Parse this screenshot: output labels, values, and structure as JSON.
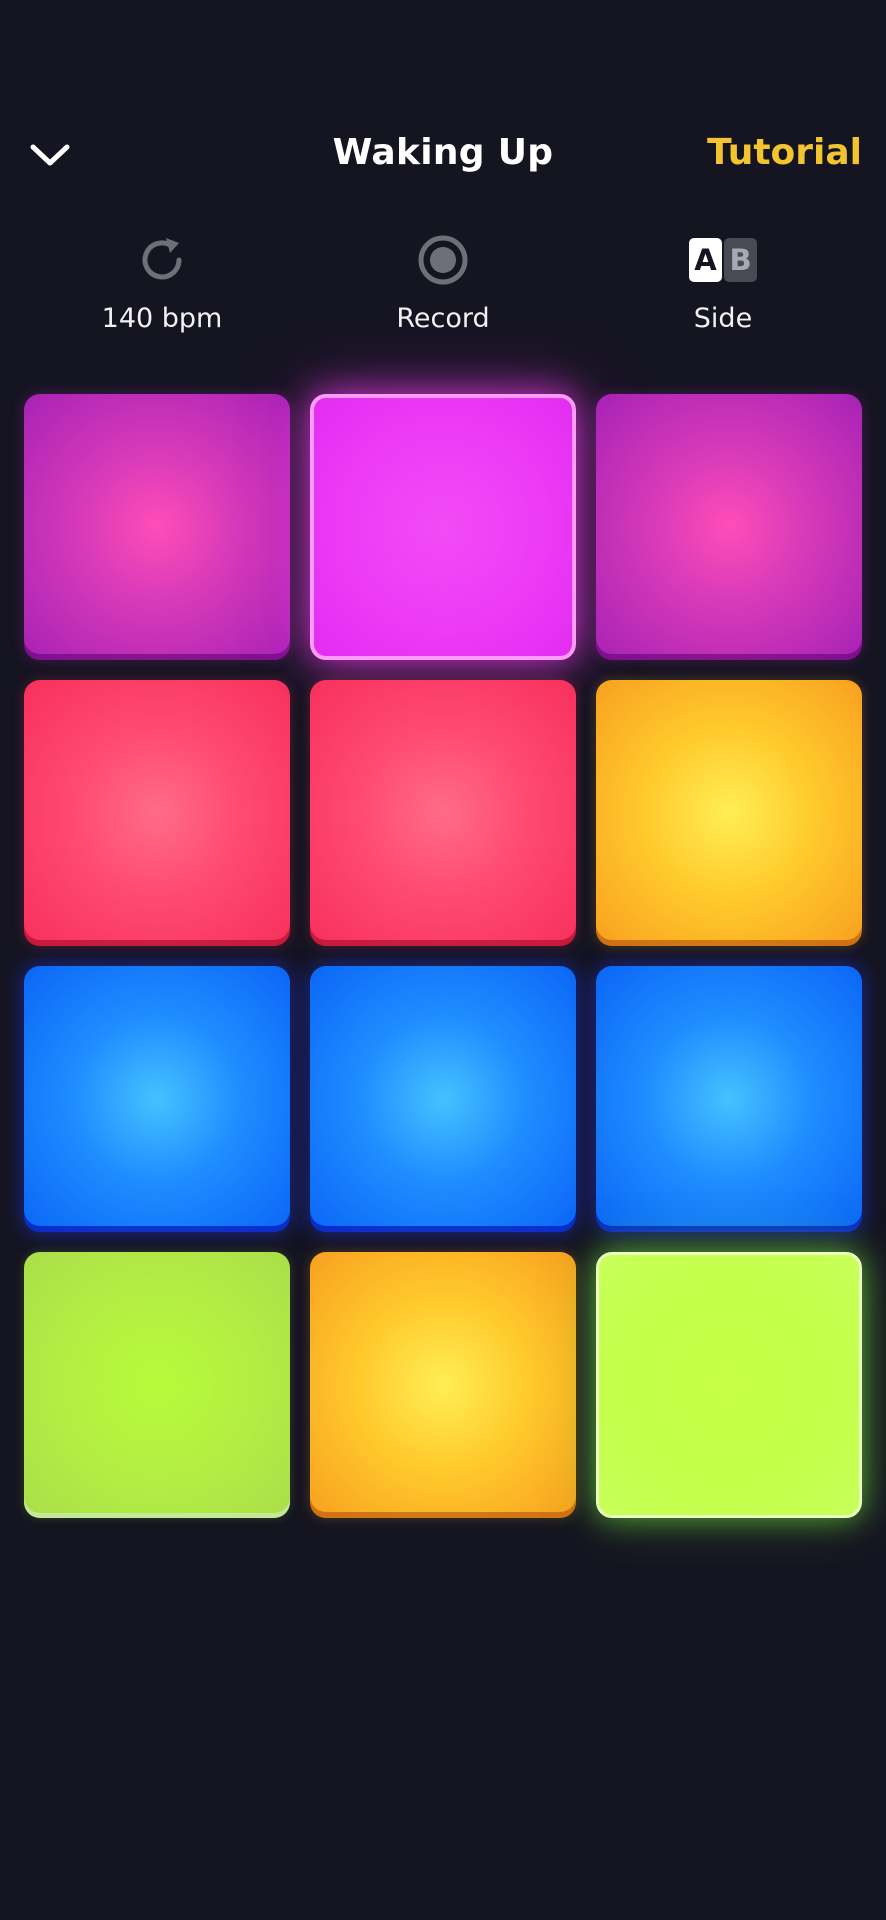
{
  "header": {
    "back_icon": "chevron-down-icon",
    "title": "Waking Up",
    "tutorial_label": "Tutorial",
    "tutorial_color": "#f4c430"
  },
  "controls": {
    "tempo": {
      "icon": "refresh-icon",
      "label": "140 bpm"
    },
    "record": {
      "icon": "record-icon",
      "label": "Record"
    },
    "side": {
      "icon": "ab-side-icon",
      "icon_letters": [
        "A",
        "B"
      ],
      "label": "Side"
    }
  },
  "pads": [
    {
      "color": "purple",
      "state": "idle"
    },
    {
      "color": "magenta",
      "state": "active"
    },
    {
      "color": "purple",
      "state": "idle"
    },
    {
      "color": "red",
      "state": "idle"
    },
    {
      "color": "red",
      "state": "idle"
    },
    {
      "color": "orange",
      "state": "idle"
    },
    {
      "color": "blue",
      "state": "idle"
    },
    {
      "color": "blue",
      "state": "idle"
    },
    {
      "color": "blue",
      "state": "idle"
    },
    {
      "color": "lime",
      "state": "idle"
    },
    {
      "color": "orange",
      "state": "idle"
    },
    {
      "color": "lime",
      "state": "active"
    }
  ],
  "colors": {
    "background": "#151421",
    "purple": "#c22fb7",
    "magenta": "#ee3cf6",
    "red": "#ff4a70",
    "orange": "#ffc52c",
    "blue": "#1e8cff",
    "lime": "#b4ef42"
  }
}
